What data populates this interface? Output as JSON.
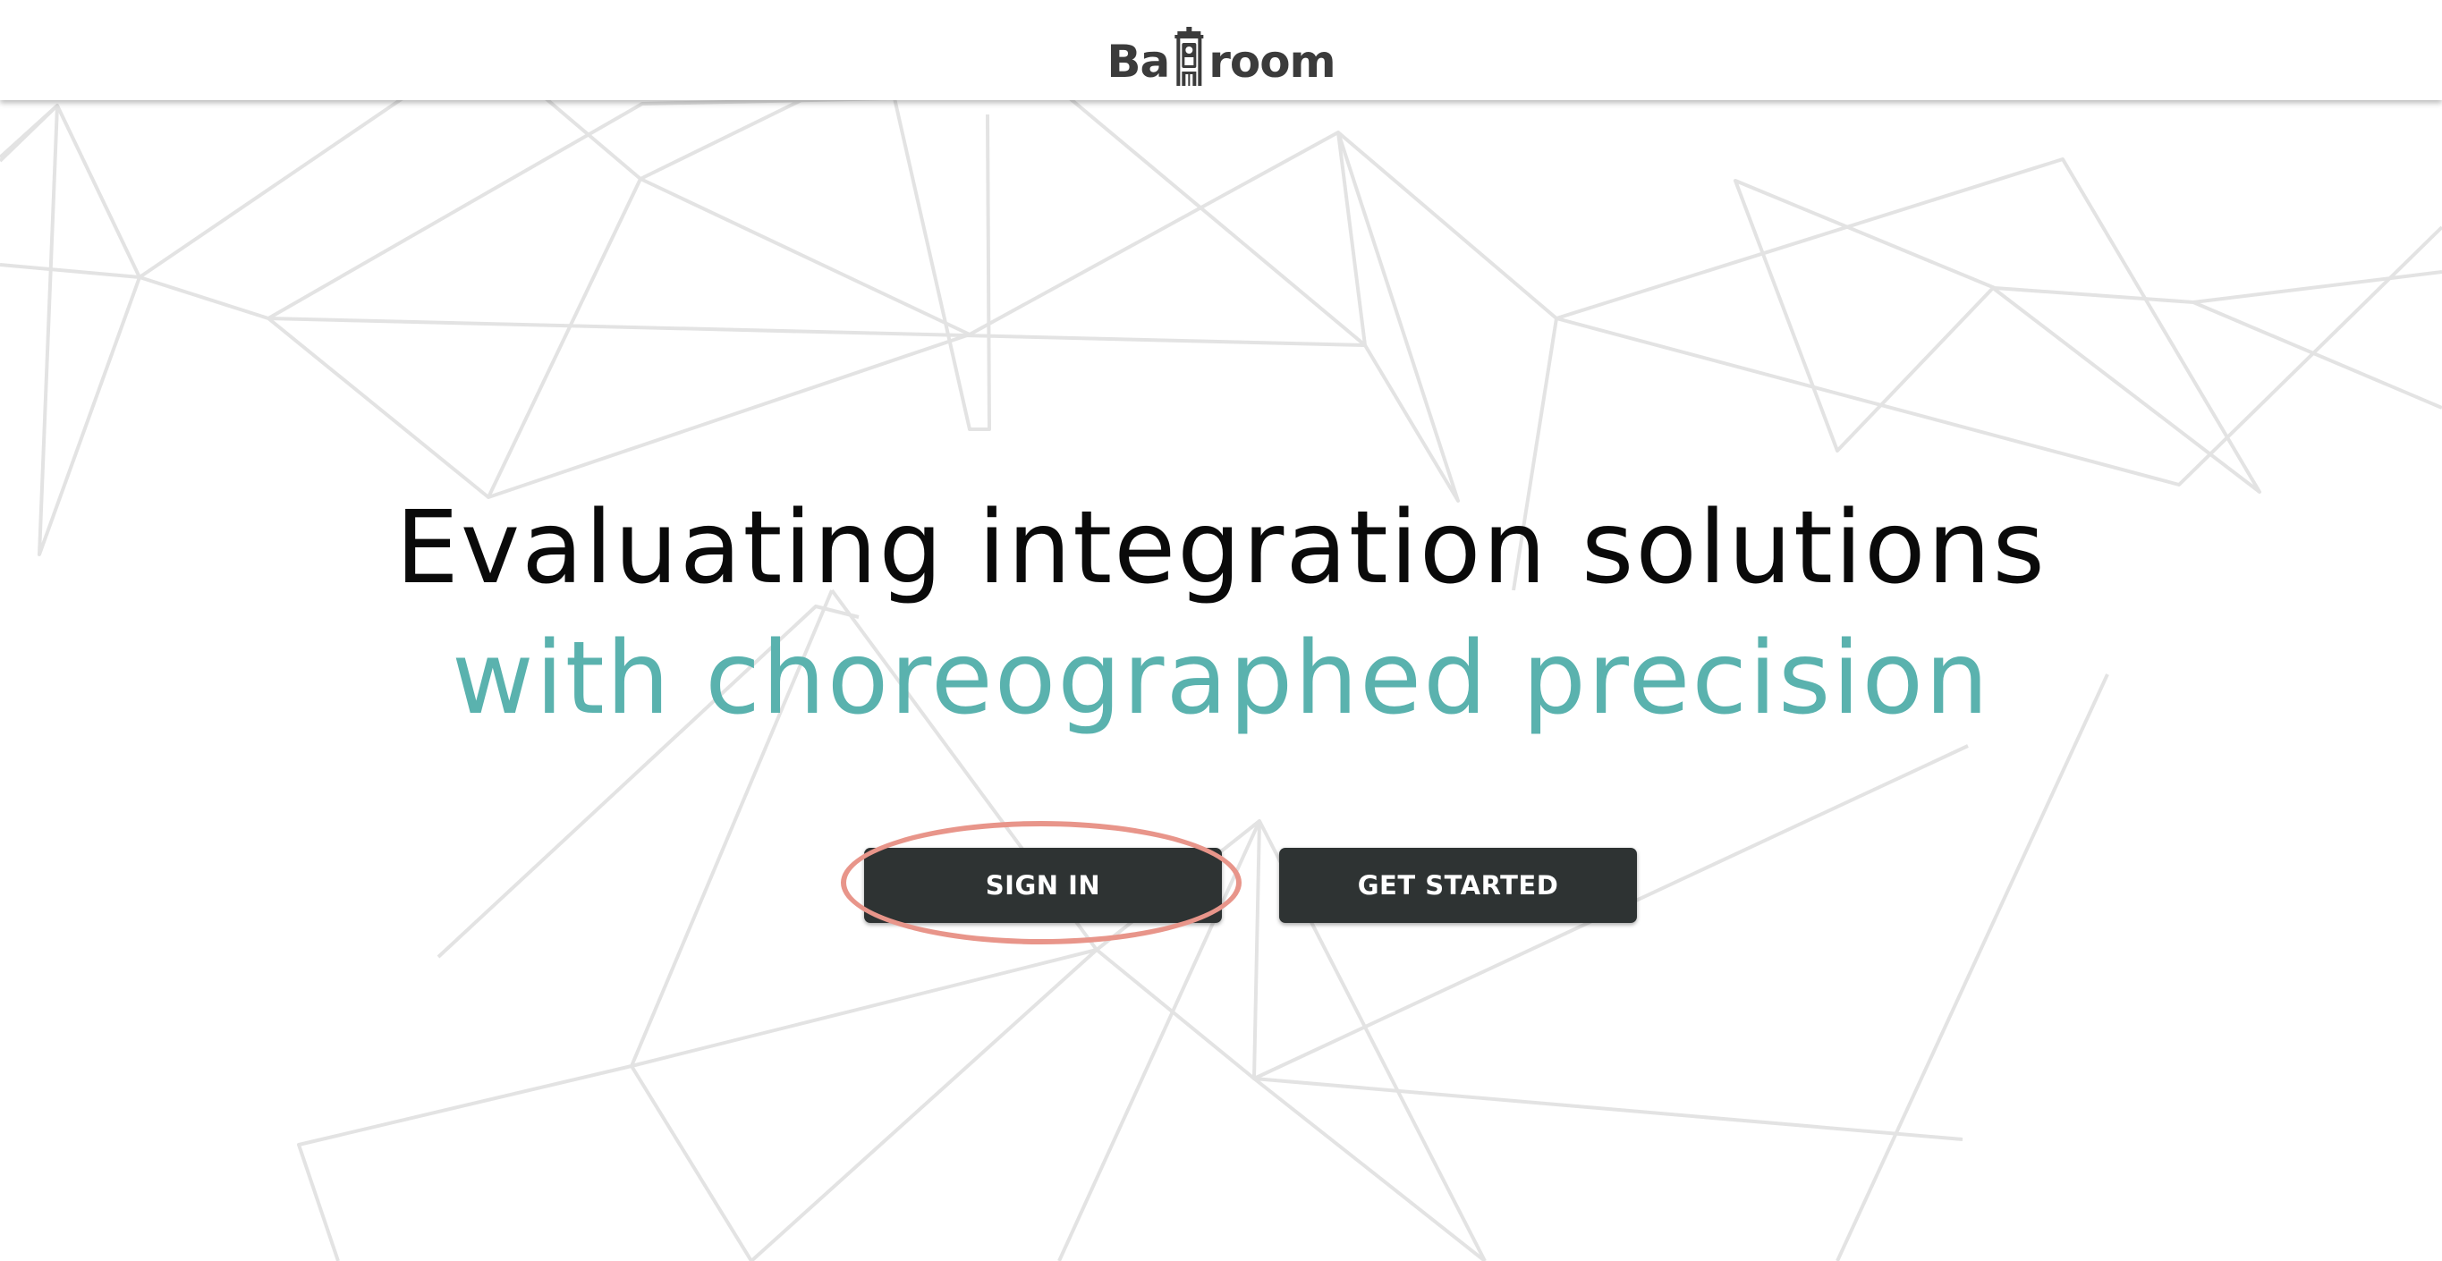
{
  "header": {
    "logo_text_left": "Ba",
    "logo_text_right": "room",
    "logo_icon": "ballroom-building-icon"
  },
  "hero": {
    "line1": "Evaluating integration solutions",
    "line2": "with choreographed precision"
  },
  "buttons": {
    "sign_in": "SIGN IN",
    "get_started": "GET STARTED"
  },
  "colors": {
    "accent": "#5ab2ae",
    "button_bg": "#2e3333",
    "button_text": "#ffffff",
    "heading": "#0a0a0a",
    "logo": "#3b3b3b",
    "background_lines": "#e3e3e3",
    "highlight_ring": "#e8958a"
  }
}
